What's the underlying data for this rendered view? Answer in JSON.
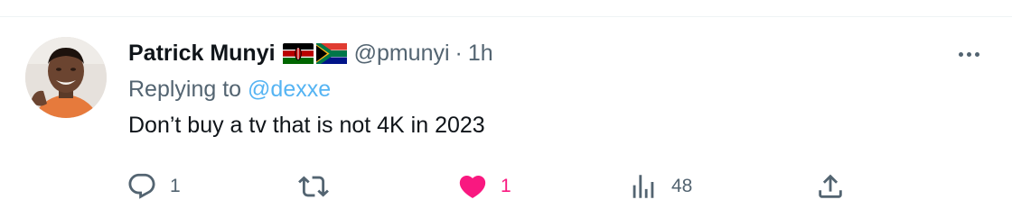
{
  "tweet": {
    "author_name": "Patrick Munyi",
    "handle": "@pmunyi",
    "separator": "·",
    "time": "1h",
    "replying_prefix": "Replying to",
    "replying_to": "@dexxe",
    "text": "Don’t buy a tv that is not 4K in 2023",
    "flags": [
      "kenya-flag",
      "south-africa-flag"
    ]
  },
  "actions": {
    "reply_count": "1",
    "retweet_count": "",
    "like_count": "1",
    "view_count": "48",
    "liked": true
  },
  "colors": {
    "like_active": "#f91880",
    "secondary_text": "#536471",
    "link": "#1d9bf0"
  }
}
